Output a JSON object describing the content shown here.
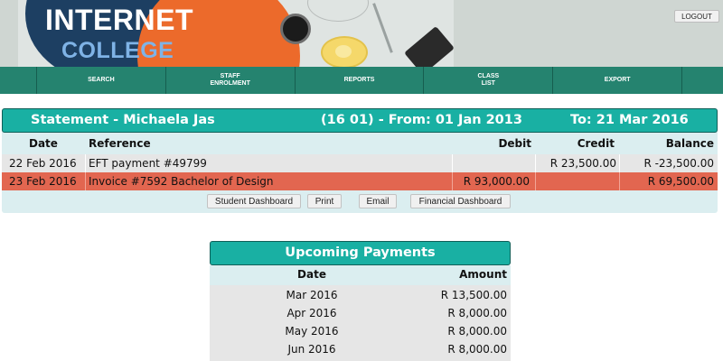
{
  "header": {
    "logo_line1": "INTERNET",
    "logo_line2": "COLLEGE",
    "logout_label": "LOGOUT"
  },
  "nav": {
    "items": [
      "SEARCH",
      "STAFF\nENROLMENT",
      "REPORTS",
      "CLASS\nLIST",
      "EXPORT"
    ]
  },
  "statement": {
    "title_name": "Statement - Michaela Jas",
    "title_id": "(16      01) - From: 01 Jan 2013",
    "title_to": "To: 21 Mar 2016",
    "columns": [
      "Date",
      "Reference",
      "Debit",
      "Credit",
      "Balance"
    ],
    "rows": [
      {
        "date": "22 Feb 2016",
        "reference": "EFT payment #49799",
        "debit": "",
        "credit": "R 23,500.00",
        "balance": "R -23,500.00"
      },
      {
        "date": "23 Feb 2016",
        "reference": "Invoice #7592 Bachelor of Design",
        "debit": "R 93,000.00",
        "credit": "",
        "balance": "R 69,500.00"
      }
    ],
    "buttons": {
      "student_dashboard": "Student Dashboard",
      "print": "Print",
      "email": "Email",
      "financial_dashboard": "Financial Dashboard"
    }
  },
  "upcoming": {
    "title": "Upcoming Payments",
    "columns": [
      "Date",
      "Amount"
    ],
    "rows": [
      {
        "date": "Mar 2016",
        "amount": "R 13,500.00"
      },
      {
        "date": "Apr 2016",
        "amount": "R 8,000.00"
      },
      {
        "date": "May 2016",
        "amount": "R 8,000.00"
      },
      {
        "date": "Jun 2016",
        "amount": "R 8,000.00"
      }
    ]
  },
  "colors": {
    "teal_header": "#19b0a3",
    "nav_green": "#25836f",
    "invoice_row_red": "#e26650",
    "table_header_bg": "#dbeef0"
  }
}
